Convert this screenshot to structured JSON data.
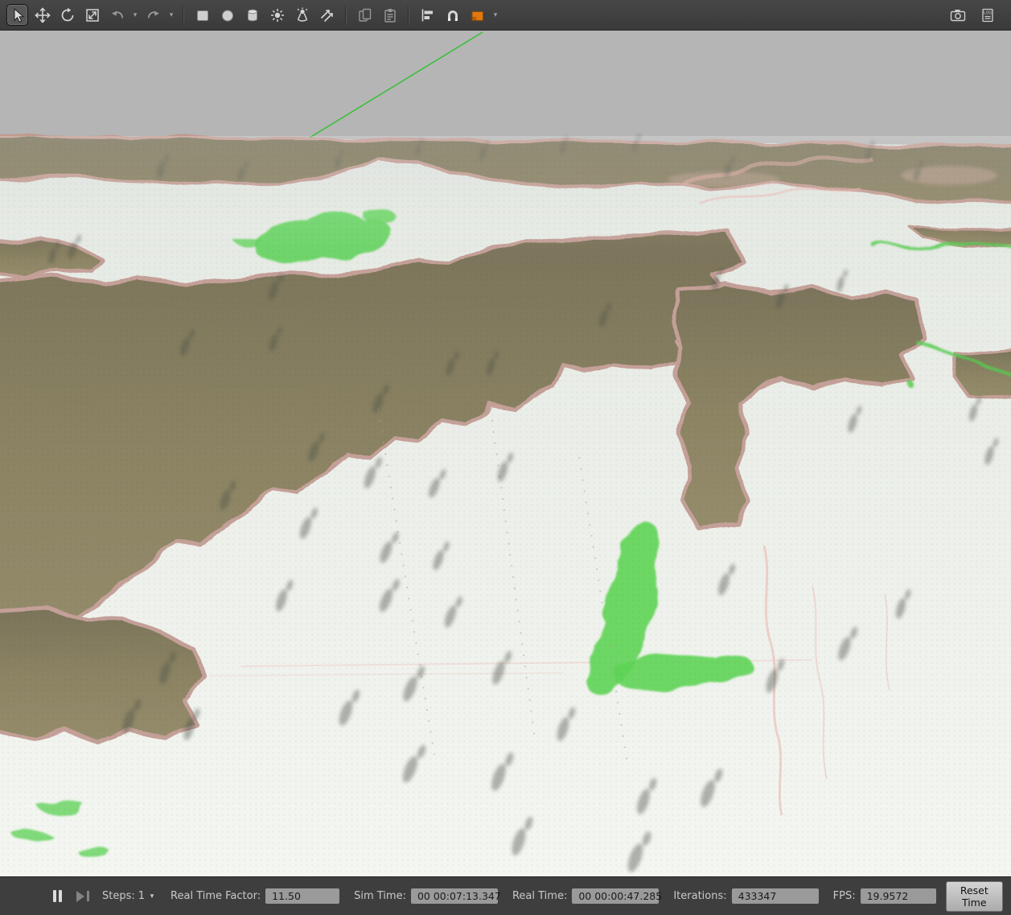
{
  "glyphs": {
    "caret_down": "▾"
  },
  "toolbar": {
    "icons": [
      {
        "name": "select-cursor",
        "active": true
      },
      {
        "name": "translate-mode"
      },
      {
        "name": "rotate-mode"
      },
      {
        "name": "scale-mode"
      },
      {
        "name": "undo"
      },
      {
        "name": "undo-history-dropdown"
      },
      {
        "name": "redo"
      },
      {
        "name": "redo-history-dropdown"
      },
      {
        "name": "insert-box"
      },
      {
        "name": "insert-sphere"
      },
      {
        "name": "insert-cylinder"
      },
      {
        "name": "point-light"
      },
      {
        "name": "spot-light"
      },
      {
        "name": "directional-light"
      },
      {
        "name": "copy"
      },
      {
        "name": "paste"
      },
      {
        "name": "align"
      },
      {
        "name": "snap"
      },
      {
        "name": "joint-creation",
        "color": "#e07812"
      },
      {
        "name": "screenshot"
      },
      {
        "name": "log-recording"
      }
    ]
  },
  "viewport": {
    "scene": "heightmap-terrain-3d-view",
    "colors": {
      "sky": "#b5b5b6",
      "ground": "#eef1ec",
      "terrain": "#8b8363",
      "terrain_edge": "#c4a098",
      "vegetation": "#63d35c",
      "marks": "#e8a7a3",
      "ray_line": "#35c035"
    }
  },
  "statusbar": {
    "steps_label": "Steps:",
    "steps_value": "1",
    "rtf_label": "Real Time Factor:",
    "rtf_value": "11.50",
    "sim_time_label": "Sim Time:",
    "sim_time_value": "00 00:07:13.347",
    "real_time_label": "Real Time:",
    "real_time_value": "00 00:00:47.285",
    "iterations_label": "Iterations:",
    "iterations_value": "433347",
    "fps_label": "FPS:",
    "fps_value": "19.9572",
    "reset_label": "Reset Time"
  }
}
